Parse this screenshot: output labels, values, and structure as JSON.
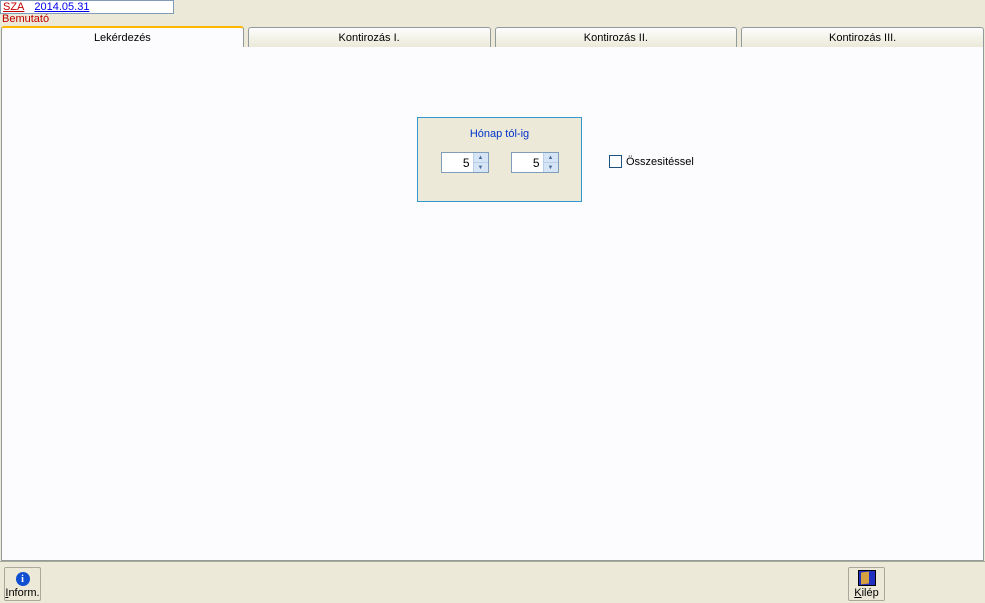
{
  "header": {
    "code": "SZA",
    "date": "2014.05.31",
    "subtitle": "Bemutató"
  },
  "tabs": [
    {
      "label": "Lekérdezés",
      "active": true
    },
    {
      "label": "Kontirozás I."
    },
    {
      "label": "Kontirozás II."
    },
    {
      "label": "Kontirozás III."
    }
  ],
  "group": {
    "title": "Hónap tól-ig",
    "from": "5",
    "to": "5"
  },
  "checkbox": {
    "label": "Összesitéssel",
    "checked": false
  },
  "buttons": {
    "inform": "Inform.",
    "exit": "Kilép"
  }
}
